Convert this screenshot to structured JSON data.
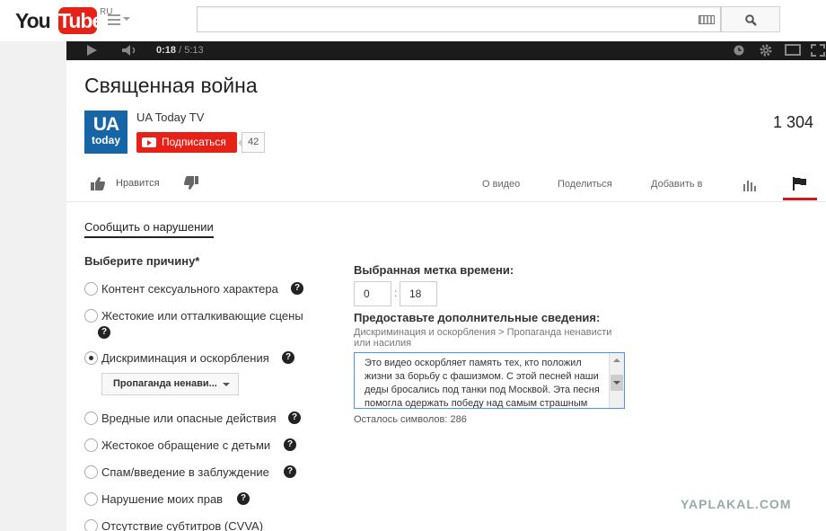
{
  "masthead": {
    "logo_you": "You",
    "logo_tube": "Tube",
    "logo_region": "RU",
    "search_placeholder": ""
  },
  "player": {
    "current_time": "0:18",
    "duration": "/ 5:13"
  },
  "video": {
    "title": "Священная война",
    "views": "1 304"
  },
  "channel": {
    "avatar_line1": "UA",
    "avatar_line2": "today",
    "name": "UA Today TV",
    "subscribe_label": "Подписаться",
    "subscriber_count": "42"
  },
  "actions": {
    "like_label": "Нравится",
    "tabs": [
      "О видео",
      "Поделиться",
      "Добавить в"
    ]
  },
  "report": {
    "title": "Сообщить о нарушении",
    "reason_heading": "Выберите причину*",
    "reasons": [
      {
        "label": "Контент сексуального характера",
        "selected": false
      },
      {
        "label": "Жестокие или отталкивающие сцены",
        "selected": false
      },
      {
        "label": "Дискриминация и оскорбления",
        "selected": true
      },
      {
        "label": "Вредные или опасные действия",
        "selected": false
      },
      {
        "label": "Жестокое обращение с детьми",
        "selected": false
      },
      {
        "label": "Спам/введение в заблуждение",
        "selected": false
      },
      {
        "label": "Нарушение моих прав",
        "selected": false
      },
      {
        "label": "Отсутствие субтитров (CVVA)",
        "selected": false
      }
    ],
    "help_glyph": "?",
    "subreason_selected": "Пропаганда ненави...",
    "timestamp_label": "Выбранная метка времени:",
    "timestamp_minutes": "0",
    "timestamp_separator": ":",
    "timestamp_seconds": "18",
    "details_label": "Предоставьте дополнительные сведения:",
    "details_path": "Дискриминация и оскорбления > Пропаганда ненависти или насилия",
    "details_text": "Это видео оскорбляет память тех, кто положил жизни за борьбу с фашизмом. С этой песней наши деды бросались под танки под Москвой. Эта песня помогла одержать победу над самым страшным",
    "chars_left": "Осталось символов: 286"
  },
  "watermark": "YAPLAKAL.COM",
  "colors": {
    "brand_red": "#e62117",
    "active_tab_underline": "#cc181e",
    "focus_border": "#4d90fe"
  }
}
